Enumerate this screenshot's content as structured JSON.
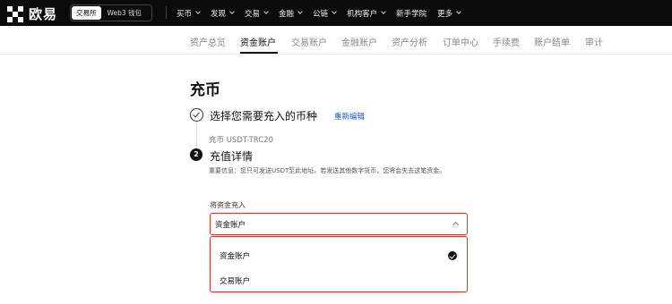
{
  "header": {
    "brand": "欧易",
    "switch": {
      "exchange_label": "交易所",
      "web3_label": "Web3 钱包"
    },
    "menu": [
      {
        "label": "买币"
      },
      {
        "label": "发现"
      },
      {
        "label": "交易"
      },
      {
        "label": "金融"
      },
      {
        "label": "公链"
      },
      {
        "label": "机构客户"
      },
      {
        "label": "新手学院"
      },
      {
        "label": "更多"
      }
    ]
  },
  "subnav": {
    "tabs": [
      {
        "label": "资产总览"
      },
      {
        "label": "资金账户"
      },
      {
        "label": "交易账户"
      },
      {
        "label": "金融账户"
      },
      {
        "label": "资产分析"
      },
      {
        "label": "订单中心"
      },
      {
        "label": "手续费"
      },
      {
        "label": "账户结单"
      },
      {
        "label": "审计"
      }
    ],
    "active_tab": "资金账户"
  },
  "page": {
    "title": "充币",
    "step1": {
      "title": "选择您需要充入的币种",
      "edit_link": "重新编辑",
      "summary": "充币 USDT-TRC20"
    },
    "step2": {
      "number": "2",
      "title": "充值详情",
      "notice": "重要信息：您只可发送USDT至此地址。若发送其他数字货币，您将会失去这笔资金。",
      "field_label": "将资金充入",
      "select_value": "资金账户",
      "options": [
        {
          "label": "资金账户",
          "selected": true
        },
        {
          "label": "交易账户",
          "selected": false
        }
      ]
    }
  },
  "colors": {
    "highlight_border": "#d9372c",
    "link": "#1a56c8",
    "nav_bg": "#0b0b0b"
  }
}
